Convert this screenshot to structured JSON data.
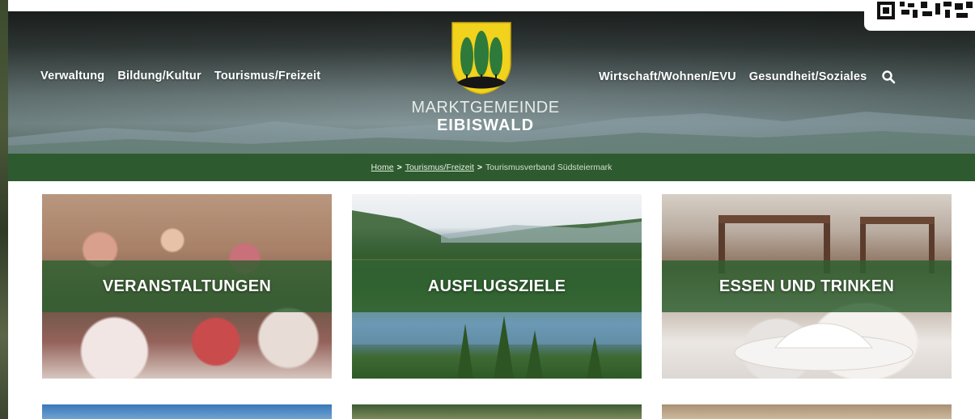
{
  "site": {
    "name_line1": "MARKTGEMEINDE",
    "name_line2": "EIBISWALD"
  },
  "nav": {
    "left": [
      {
        "label": "Verwaltung"
      },
      {
        "label": "Bildung/Kultur"
      },
      {
        "label": "Tourismus/Freizeit"
      }
    ],
    "right": [
      {
        "label": "Wirtschaft/Wohnen/EVU"
      },
      {
        "label": "Gesundheit/Soziales"
      }
    ],
    "search_icon": "search-icon"
  },
  "breadcrumb": {
    "home": "Home",
    "section": "Tourismus/Freizeit",
    "current": "Tourismusverband Südsteiermark",
    "separator": ">"
  },
  "tiles": [
    {
      "label": "VERANSTALTUNGEN"
    },
    {
      "label": "AUSFLUGSZIELE"
    },
    {
      "label": "ESSEN UND TRINKEN"
    }
  ],
  "colors": {
    "brand_green": "#2d5a2e",
    "tile_band": "#2d5f30",
    "crest_yellow": "#f1d21c",
    "crest_tree": "#2e7a3a"
  }
}
